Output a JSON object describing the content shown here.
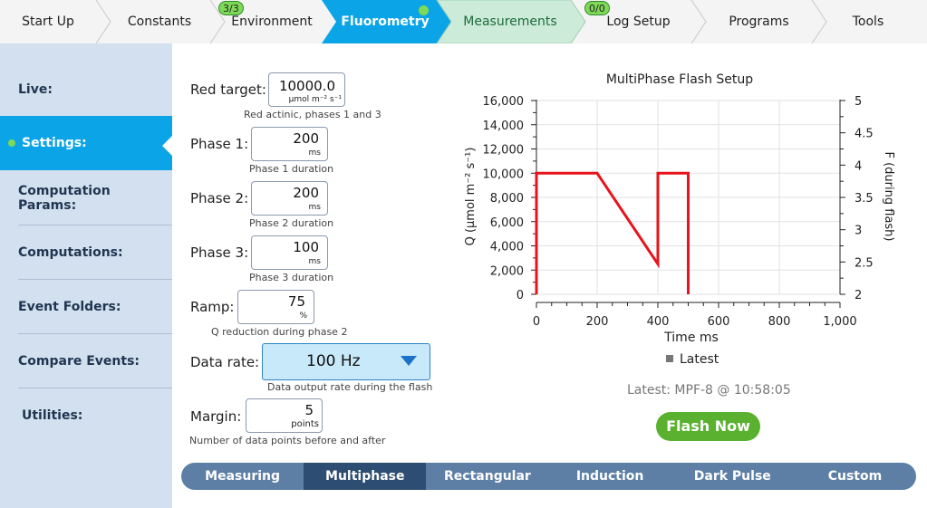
{
  "topnav": {
    "tabs": [
      {
        "label": "Start Up"
      },
      {
        "label": "Constants"
      },
      {
        "label": "Environment",
        "badge": "3/3"
      },
      {
        "label": "Fluorometry",
        "active": true
      },
      {
        "label": "Measurements"
      },
      {
        "label": "Log Setup",
        "badge": "0/0"
      },
      {
        "label": "Programs"
      },
      {
        "label": "Tools"
      }
    ]
  },
  "sidebar": {
    "items": [
      {
        "label": "Live:"
      },
      {
        "label": "Settings:",
        "active": true
      },
      {
        "label": "Computation Params:"
      },
      {
        "label": "Computations:"
      },
      {
        "label": "Event Folders:"
      },
      {
        "label": "Compare Events:"
      },
      {
        "label": "Utilities:"
      }
    ]
  },
  "form": {
    "red_target": {
      "label": "Red target:",
      "value": "10000.0",
      "unit": "µmol m⁻² s⁻¹",
      "help": "Red actinic, phases 1 and 3"
    },
    "phase1": {
      "label": "Phase 1:",
      "value": "200",
      "unit": "ms",
      "help": "Phase 1 duration"
    },
    "phase2": {
      "label": "Phase 2:",
      "value": "200",
      "unit": "ms",
      "help": "Phase 2 duration"
    },
    "phase3": {
      "label": "Phase 3:",
      "value": "100",
      "unit": "ms",
      "help": "Phase 3 duration"
    },
    "ramp": {
      "label": "Ramp:",
      "value": "75",
      "unit": "%",
      "help": "Q reduction during phase 2"
    },
    "data_rate": {
      "label": "Data rate:",
      "value": "100 Hz",
      "help": "Data output rate during the flash"
    },
    "margin": {
      "label": "Margin:",
      "value": "5",
      "unit": "points",
      "help": "Number of data points before and after"
    }
  },
  "chart_data": {
    "type": "line",
    "title": "MultiPhase Flash Setup",
    "xlabel": "Time ms",
    "ylabel": "Q (µmol m⁻² s⁻¹)",
    "y2label": "F (during flash)",
    "xlim": [
      0,
      1000
    ],
    "ylim": [
      0,
      16000
    ],
    "y2lim": [
      2,
      5
    ],
    "xticks": [
      "0",
      "200",
      "400",
      "600",
      "800",
      "1,000"
    ],
    "yticks": [
      "0",
      "2,000",
      "4,000",
      "6,000",
      "8,000",
      "10,000",
      "12,000",
      "14,000",
      "16,000"
    ],
    "y2ticks": [
      "2",
      "2.5",
      "3",
      "3.5",
      "4",
      "4.5",
      "5"
    ],
    "grid": true,
    "legend": "bottom",
    "series": [
      {
        "name": "Latest",
        "color": "#e8131c",
        "x": [
          0,
          0,
          200,
          400,
          400,
          500,
          500
        ],
        "y": [
          0,
          10000,
          10000,
          2500,
          10000,
          10000,
          0
        ]
      }
    ]
  },
  "latest_text": "Latest: MPF-8 @ 10:58:05",
  "flash_button": "Flash Now",
  "modes": [
    {
      "label": "Measuring"
    },
    {
      "label": "Multiphase",
      "active": true
    },
    {
      "label": "Rectangular"
    },
    {
      "label": "Induction"
    },
    {
      "label": "Dark Pulse"
    },
    {
      "label": "Custom"
    }
  ]
}
